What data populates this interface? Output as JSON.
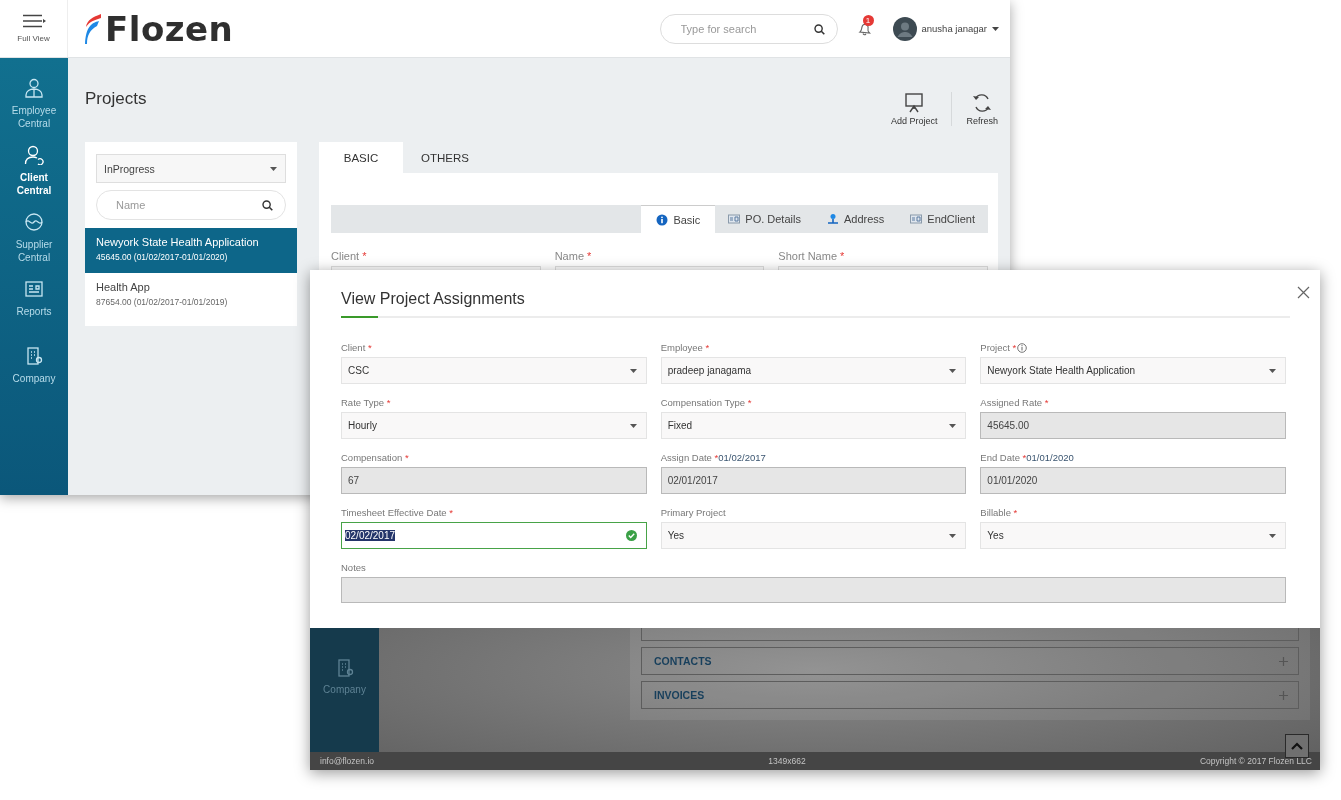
{
  "app_window": {
    "header": {
      "menu_label": "Full View",
      "logo_text": "Flozen",
      "search": {
        "placeholder": "Type for search"
      },
      "notification_count": "1",
      "user_name": "anusha janagar"
    },
    "sidebar": {
      "items": [
        {
          "label": "Employee Central",
          "kind": "employee",
          "selected": false
        },
        {
          "label": "Client Central",
          "kind": "client",
          "selected": true
        },
        {
          "label": "Supplier Central",
          "kind": "supplier",
          "selected": false
        },
        {
          "label": "Reports",
          "kind": "reports",
          "selected": false
        },
        {
          "label": "Company",
          "kind": "company",
          "selected": false
        }
      ]
    },
    "page_title": "Projects",
    "toolbar": [
      {
        "label": "Add Project",
        "kind": "add"
      },
      {
        "label": "Refresh",
        "kind": "refresh"
      }
    ],
    "project_list": {
      "status_filter": "InProgress",
      "search": {
        "placeholder": "Name"
      },
      "items": [
        {
          "name": "Newyork State Health Application",
          "detail": "45645.00 (01/02/2017-01/01/2020)",
          "selected": true
        },
        {
          "name": "Health App",
          "detail": "87654.00 (01/02/2017-01/01/2019)",
          "selected": false
        }
      ]
    },
    "tabs": [
      {
        "label": "BASIC",
        "selected": true
      },
      {
        "label": "OTHERS",
        "selected": false
      }
    ],
    "section_tabs": [
      {
        "label": "Basic",
        "kind": "info",
        "selected": true
      },
      {
        "label": "PO. Details",
        "kind": "document",
        "selected": false
      },
      {
        "label": "Address",
        "kind": "pin",
        "selected": false
      },
      {
        "label": "EndClient",
        "kind": "document",
        "selected": false
      }
    ],
    "fields": [
      {
        "label": "Client",
        "required_mark": "*"
      },
      {
        "label": "Name",
        "required_mark": "*"
      },
      {
        "label": "Short Name",
        "required_mark": "*"
      }
    ]
  },
  "assignment_window": {
    "dialog": {
      "title": "View Project Assignments",
      "fields": [
        {
          "label": "Client",
          "required_mark": "*",
          "info": false,
          "kind": "select",
          "value": "CSC"
        },
        {
          "label": "Employee",
          "required_mark": "*",
          "info": false,
          "kind": "select",
          "value": "pradeep janagama"
        },
        {
          "label": "Project",
          "required_mark": "*",
          "info": true,
          "kind": "select",
          "value": "Newyork State Health Application"
        },
        {
          "label": "Rate Type",
          "required_mark": "*",
          "info": false,
          "kind": "select",
          "value": "Hourly"
        },
        {
          "label": "Compensation Type",
          "required_mark": "*",
          "info": false,
          "kind": "select",
          "value": "Fixed"
        },
        {
          "label": "Assigned Rate",
          "required_mark": "*",
          "info": false,
          "kind": "readonly",
          "value": "45645.00"
        },
        {
          "label": "Compensation",
          "required_mark": "*",
          "info": false,
          "kind": "readonly",
          "value": "67"
        },
        {
          "label": "Assign Date",
          "required_mark": "*",
          "info": false,
          "hint": "01/02/2017",
          "kind": "readonly",
          "value": "02/01/2017"
        },
        {
          "label": "End Date",
          "required_mark": "*",
          "info": false,
          "hint": "01/01/2020",
          "kind": "readonly",
          "value": "01/01/2020"
        },
        {
          "label": "Timesheet Effective Date",
          "required_mark": "*",
          "info": false,
          "kind": "focused",
          "value": "02/02/2017"
        },
        {
          "label": "Primary Project",
          "info": false,
          "kind": "select",
          "value": "Yes"
        },
        {
          "label": "Billable",
          "required_mark": "*",
          "info": false,
          "kind": "select",
          "value": "Yes"
        }
      ],
      "notes": {
        "label": "Notes"
      }
    },
    "background": {
      "sidebar_items": [
        {
          "label": "Company",
          "kind": "company"
        }
      ],
      "sections": [
        {
          "label": "CONTACTS"
        },
        {
          "label": "INVOICES"
        }
      ],
      "footer": {
        "email": "info@flozen.io",
        "resolution": "1349x662",
        "copyright": "Copyright © 2017 Flozen LLC"
      }
    }
  }
}
